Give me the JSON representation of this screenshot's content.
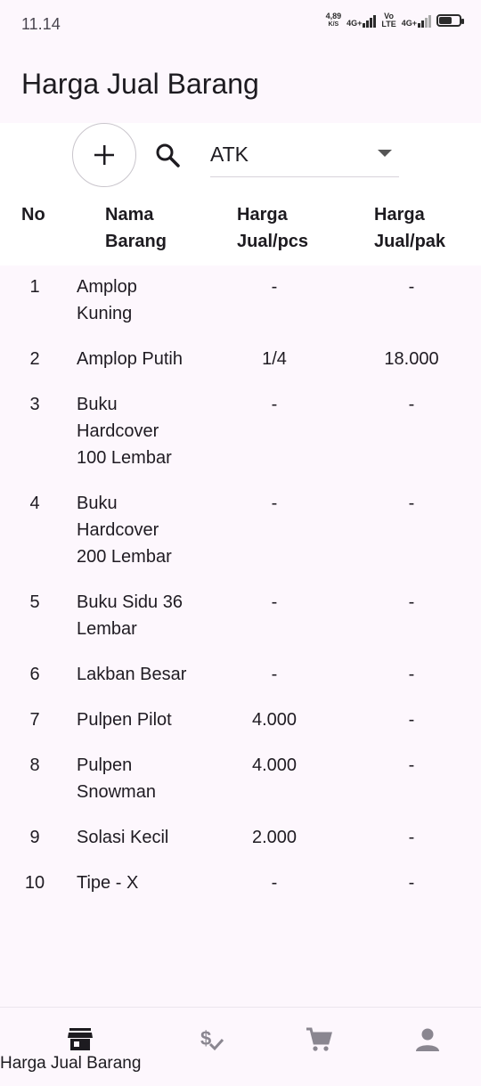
{
  "status": {
    "time": "11.14",
    "speed_value": "4,89",
    "speed_unit": "K/S",
    "net1": "4G+",
    "volte_top": "Vo",
    "volte_bottom": "LTE",
    "net2": "4G+"
  },
  "appbar": {
    "title": "Harga Jual Barang"
  },
  "toolbar": {
    "category_selected": "ATK"
  },
  "table": {
    "headers": {
      "no": "No",
      "name_line1": "Nama",
      "name_line2": "Barang",
      "pcs_line1": "Harga",
      "pcs_line2": "Jual/pcs",
      "pak_line1": "Harga",
      "pak_line2": "Jual/pak"
    },
    "rows": [
      {
        "no": "1",
        "name": "Amplop Kuning",
        "pcs": "-",
        "pak": "-"
      },
      {
        "no": "2",
        "name": "Amplop Putih",
        "pcs": "1/4",
        "pak": "18.000"
      },
      {
        "no": "3",
        "name": "Buku Hardcover 100 Lembar",
        "pcs": "-",
        "pak": "-"
      },
      {
        "no": "4",
        "name": "Buku Hardcover 200 Lembar",
        "pcs": "-",
        "pak": "-"
      },
      {
        "no": "5",
        "name": "Buku Sidu 36 Lembar",
        "pcs": "-",
        "pak": "-"
      },
      {
        "no": "6",
        "name": "Lakban Besar",
        "pcs": "-",
        "pak": "-"
      },
      {
        "no": "7",
        "name": "Pulpen Pilot",
        "pcs": "4.000",
        "pak": "-"
      },
      {
        "no": "8",
        "name": "Pulpen Snowman",
        "pcs": "4.000",
        "pak": "-"
      },
      {
        "no": "9",
        "name": "Solasi Kecil",
        "pcs": "2.000",
        "pak": "-"
      },
      {
        "no": "10",
        "name": "Tipe - X",
        "pcs": "-",
        "pak": "-"
      }
    ]
  },
  "bottom_nav": {
    "active_label": "Harga Jual Barang",
    "items": [
      "store-icon",
      "price-check-icon",
      "cart-icon",
      "person-icon"
    ]
  },
  "colors": {
    "background": "#fdf7fd",
    "surface": "#ffffff",
    "inactive_icon": "#8a8690"
  }
}
